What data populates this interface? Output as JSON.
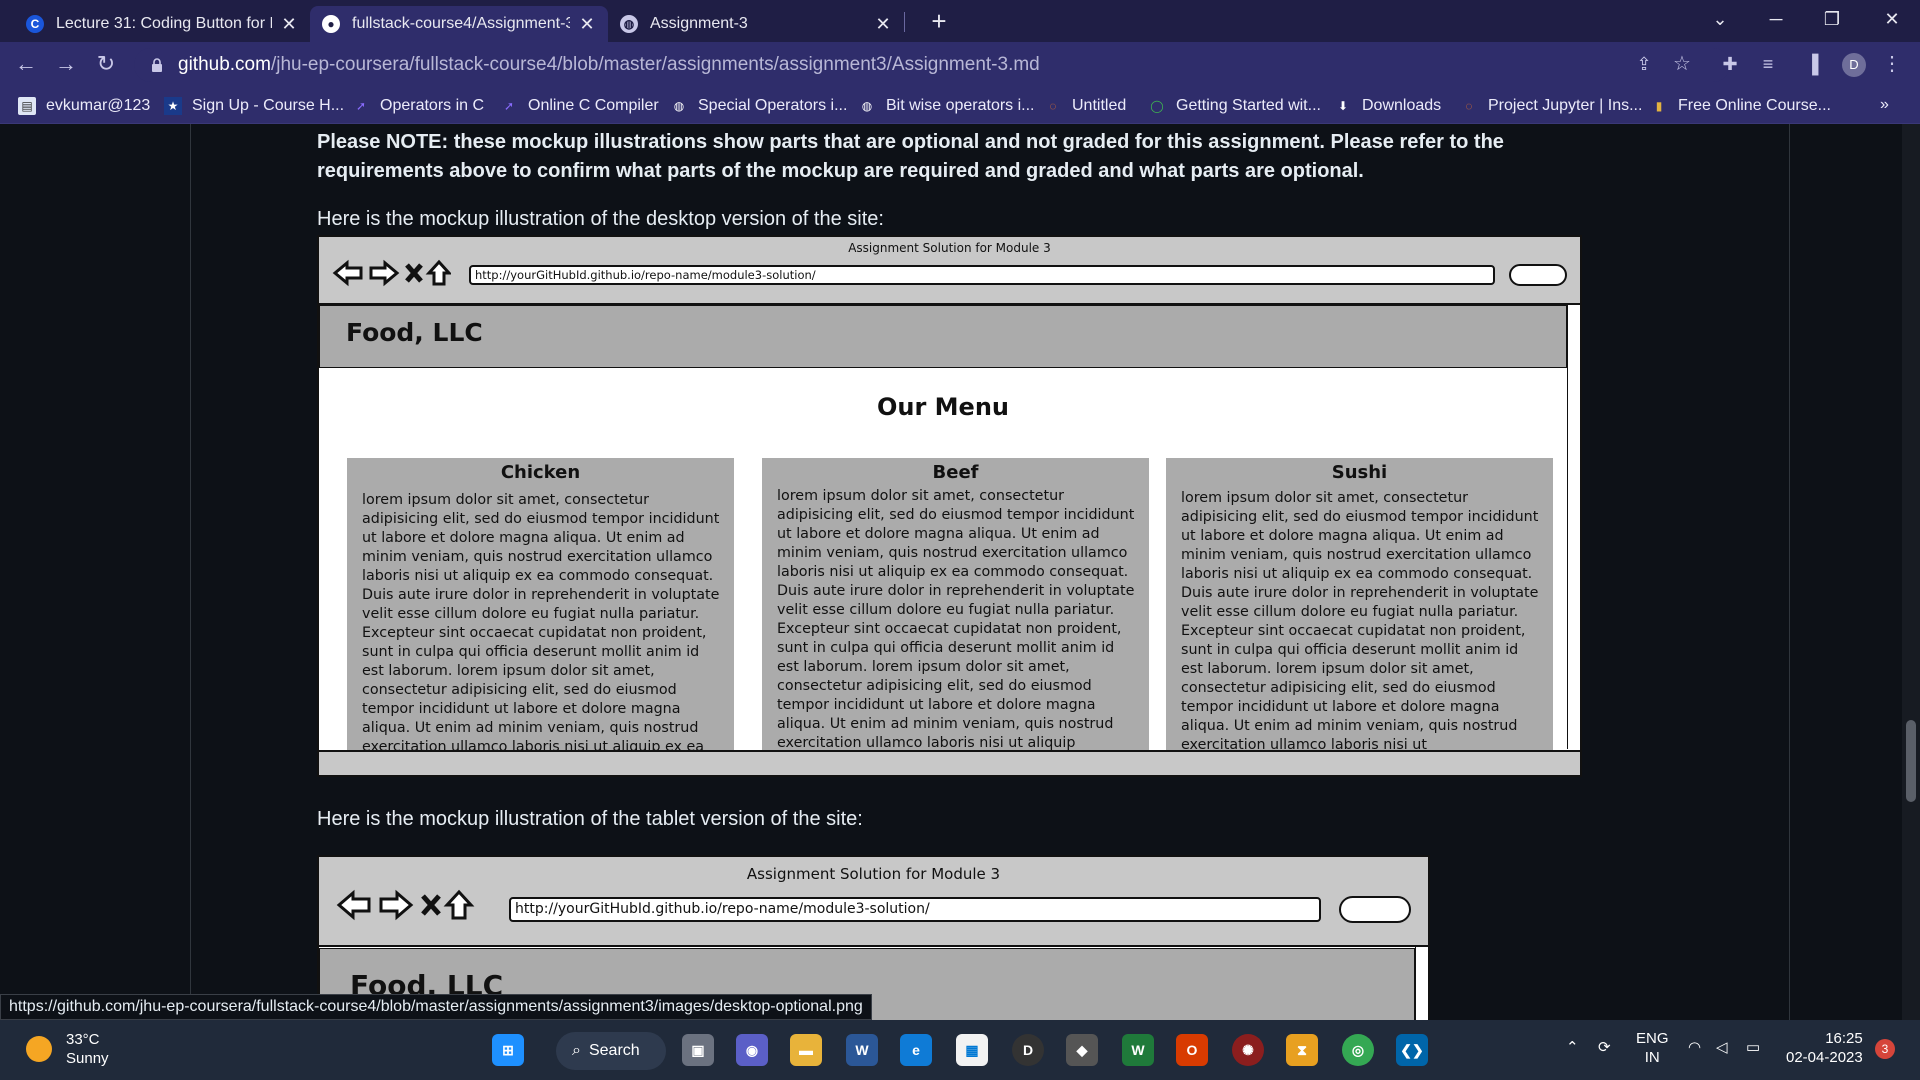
{
  "browser": {
    "tabs": [
      {
        "title": "Lecture 31: Coding Button for Fu",
        "favicon": "coursera-icon",
        "active": false
      },
      {
        "title": "fullstack-course4/Assignment-3.r",
        "favicon": "github-icon",
        "active": true
      },
      {
        "title": "Assignment-3",
        "favicon": "globe-icon",
        "active": false
      }
    ],
    "url_domain": "github.com",
    "url_path": "/jhu-ep-coursera/fullstack-course4/blob/master/assignments/assignment3/Assignment-3.md",
    "profile_initial": "D",
    "bookmarks": [
      {
        "label": "evkumar@123",
        "icon": "bookmark-page-icon"
      },
      {
        "label": "Sign Up - Course H...",
        "icon": "star-icon"
      },
      {
        "label": "Operators in C",
        "icon": "bookmark-arrow-icon"
      },
      {
        "label": "Online C Compiler",
        "icon": "bookmark-arrow-icon"
      },
      {
        "label": "Special Operators i...",
        "icon": "globe-icon"
      },
      {
        "label": "Bit wise operators i...",
        "icon": "globe-icon"
      },
      {
        "label": "Untitled",
        "icon": "jupyter-icon"
      },
      {
        "label": "Getting Started wit...",
        "icon": "circle-icon"
      },
      {
        "label": "Downloads",
        "icon": "download-icon"
      },
      {
        "label": "Project Jupyter | Ins...",
        "icon": "jupyter-icon"
      },
      {
        "label": "Free Online Course...",
        "icon": "course-icon"
      }
    ],
    "bookmarks_overflow": "»"
  },
  "content": {
    "note": "Please NOTE: these mockup illustrations show parts that are optional and not graded for this assignment. Please refer to the requirements above to confirm what parts of the mockup are required and graded and what parts are optional.",
    "desktop_caption": "Here is the mockup illustration of the desktop version of the site:",
    "tablet_caption": "Here is the mockup illustration of the tablet version of the site:"
  },
  "mockup": {
    "window_title": "Assignment Solution for Module 3",
    "url": "http://yourGitHubId.github.io/repo-name/module3-solution/",
    "brand": "Food, LLC",
    "tablet_brand": "Food, LLC",
    "menu_title": "Our Menu",
    "columns": [
      {
        "heading": "Chicken",
        "text": "lorem ipsum dolor sit amet, consectetur adipisicing elit, sed do eiusmod tempor incididunt ut labore et dolore magna aliqua. Ut enim ad minim veniam, quis nostrud exercitation ullamco laboris nisi ut aliquip ex ea commodo consequat. Duis aute irure dolor in reprehenderit in voluptate velit esse cillum dolore eu fugiat nulla pariatur. Excepteur sint occaecat cupidatat non proident, sunt in culpa qui officia deserunt mollit anim id est laborum. lorem ipsum dolor sit amet, consectetur adipisicing elit, sed do eiusmod tempor incididunt ut labore et dolore magna aliqua. Ut enim ad minim veniam, quis nostrud exercitation ullamco laboris nisi ut aliquip ex ea"
      },
      {
        "heading": "Beef",
        "text": "lorem ipsum dolor sit amet, consectetur adipisicing elit, sed do eiusmod tempor incididunt ut labore et dolore magna aliqua. Ut enim ad minim veniam, quis nostrud exercitation ullamco laboris nisi ut aliquip ex ea commodo consequat. Duis aute irure dolor in reprehenderit in voluptate velit esse cillum dolore eu fugiat nulla pariatur. Excepteur sint occaecat cupidatat non proident, sunt in culpa qui officia deserunt mollit anim id est laborum. lorem ipsum dolor sit amet, consectetur adipisicing elit, sed do eiusmod tempor incididunt ut labore et dolore magna aliqua. Ut enim ad minim veniam, quis nostrud exercitation ullamco laboris nisi ut aliquip"
      },
      {
        "heading": "Sushi",
        "text": "lorem ipsum dolor sit amet, consectetur adipisicing elit, sed do eiusmod tempor incididunt ut labore et dolore magna aliqua. Ut enim ad minim veniam, quis nostrud exercitation ullamco laboris nisi ut aliquip ex ea commodo consequat. Duis aute irure dolor in reprehenderit in voluptate velit esse cillum dolore eu fugiat nulla pariatur. Excepteur sint occaecat cupidatat non proident, sunt in culpa qui officia deserunt mollit anim id est laborum. lorem ipsum dolor sit amet, consectetur adipisicing elit, sed do eiusmod tempor incididunt ut labore et dolore magna aliqua. Ut enim ad minim veniam, quis nostrud exercitation ullamco laboris nisi ut"
      }
    ]
  },
  "status_url": "https://github.com/jhu-ep-coursera/fullstack-course4/blob/master/assignments/assignment3/images/desktop-optional.png",
  "taskbar": {
    "temperature": "33°C",
    "condition": "Sunny",
    "search_label": "Search",
    "lang_top": "ENG",
    "lang_bottom": "IN",
    "time": "16:25",
    "date": "02-04-2023",
    "notification_count": "3",
    "chrome_badge": "D"
  },
  "colors": {
    "tabstrip": "#1f1e45",
    "toolbar": "#2f2d6b",
    "page_bg": "#0d1117",
    "taskbar": "#202a3a"
  }
}
